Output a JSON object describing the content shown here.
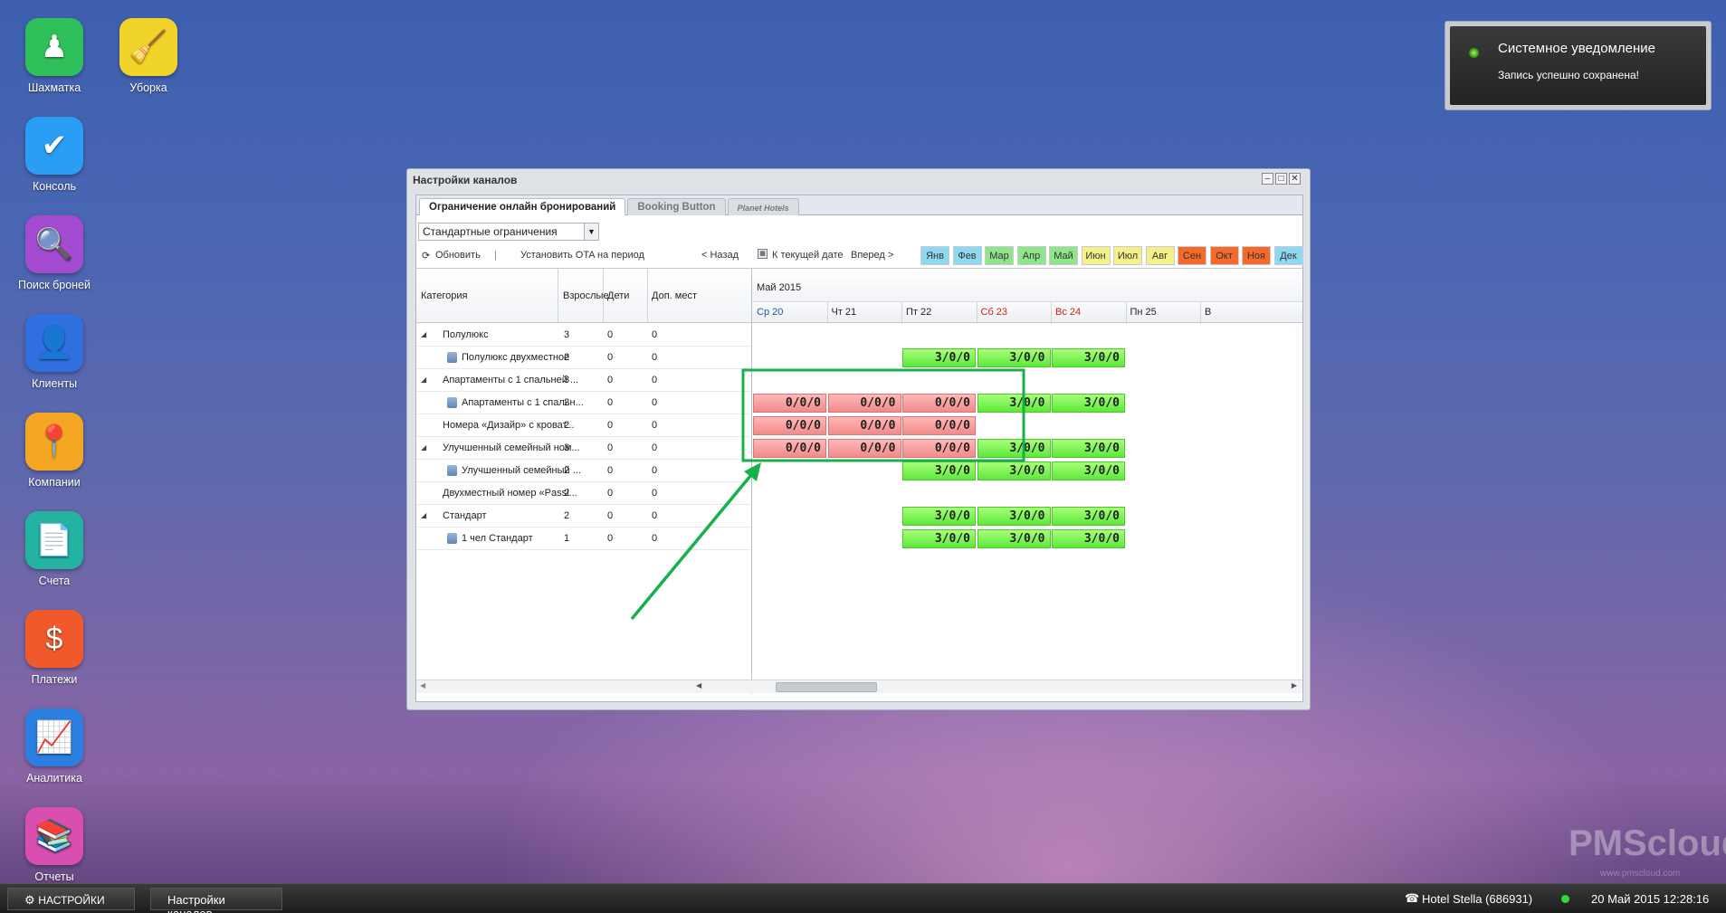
{
  "desktop": {
    "icons": [
      {
        "label": "Шахматка",
        "icon": "chess-pawn-icon",
        "color": "#2fbf5a"
      },
      {
        "label": "Уборка",
        "icon": "broom-icon",
        "color": "#f0d42a"
      },
      {
        "label": "Консоль",
        "icon": "checkmark-icon",
        "color": "#2a9df4"
      },
      {
        "label": "Поиск броней",
        "icon": "magnifier-icon",
        "color": "#a34bd1"
      },
      {
        "label": "Клиенты",
        "icon": "user-icon",
        "color": "#2f6fe0"
      },
      {
        "label": "Компании",
        "icon": "map-pin-icon",
        "color": "#f5a623"
      },
      {
        "label": "Счета",
        "icon": "document-icon",
        "color": "#23b3a0"
      },
      {
        "label": "Платежи",
        "icon": "dollar-icon",
        "color": "#f05a2a"
      },
      {
        "label": "Аналитика",
        "icon": "chart-line-icon",
        "color": "#2b7fe0"
      },
      {
        "label": "Отчеты",
        "icon": "books-icon",
        "color": "#d94fb0"
      }
    ]
  },
  "notification": {
    "title": "Системное уведомление",
    "message": "Запись успешно сохранена!"
  },
  "window": {
    "title": "Настройки каналов",
    "tabs": [
      "Ограничение онлайн бронирований",
      "Booking Button",
      "Planet Hotels"
    ],
    "restriction_select": "Стандартные ограничения",
    "toolbar": {
      "refresh": "Обновить",
      "divider": "|",
      "set_ota": "Установить OTA на период",
      "back": "< Назад",
      "today": "К текущей дате",
      "forward": "Вперед >"
    },
    "months": [
      {
        "label": "Янв",
        "color": "#8fd8f2"
      },
      {
        "label": "Фев",
        "color": "#8fd8f2"
      },
      {
        "label": "Мар",
        "color": "#8fe58a"
      },
      {
        "label": "Апр",
        "color": "#8fe58a"
      },
      {
        "label": "Май",
        "color": "#8fe58a"
      },
      {
        "label": "Июн",
        "color": "#f4f08a"
      },
      {
        "label": "Июл",
        "color": "#f4f08a"
      },
      {
        "label": "Авг",
        "color": "#f4f08a"
      },
      {
        "label": "Сен",
        "color": "#f56a2a"
      },
      {
        "label": "Окт",
        "color": "#f56a2a"
      },
      {
        "label": "Ноя",
        "color": "#f56a2a"
      },
      {
        "label": "Дек",
        "color": "#8fd8f2"
      }
    ],
    "columns": {
      "category": "Категория",
      "adults": "Взрослые",
      "children": "Дети",
      "extra": "Доп. мест"
    },
    "period": "Май 2015",
    "days": [
      {
        "label": "Ср 20",
        "color": "#1a5aa8"
      },
      {
        "label": "Чт 21",
        "color": "#222222"
      },
      {
        "label": "Пт 22",
        "color": "#222222"
      },
      {
        "label": "Сб 23",
        "color": "#d02020"
      },
      {
        "label": "Вс 24",
        "color": "#d02020"
      },
      {
        "label": "Пн 25",
        "color": "#222222"
      },
      {
        "label": "В",
        "color": "#222222"
      }
    ],
    "rows": [
      {
        "name": "Полулюкс",
        "group": true,
        "adults": "3",
        "children": "0",
        "extra": "0",
        "cells": [
          "",
          "",
          "",
          "",
          "",
          ""
        ]
      },
      {
        "name": "Полулюкс двухместное",
        "group": false,
        "icon": true,
        "adults": "2",
        "children": "0",
        "extra": "0",
        "cells": [
          "",
          "",
          "3/0/0",
          "3/0/0",
          "3/0/0",
          ""
        ]
      },
      {
        "name": "Апартаменты с 1 спальней ...",
        "group": true,
        "adults": "3",
        "children": "0",
        "extra": "0",
        "cells": [
          "",
          "",
          "",
          "",
          "",
          ""
        ]
      },
      {
        "name": "Апартаменты с 1 спальн...",
        "group": false,
        "icon": true,
        "adults": "2",
        "children": "0",
        "extra": "0",
        "cells": [
          "0/0/0",
          "0/0/0",
          "0/0/0",
          "3/0/0",
          "3/0/0",
          ""
        ]
      },
      {
        "name": "Номера «Дизайр» с кроват...",
        "group": false,
        "icon": false,
        "adults": "2",
        "children": "0",
        "extra": "0",
        "cells": [
          "0/0/0",
          "0/0/0",
          "0/0/0",
          "",
          "",
          ""
        ]
      },
      {
        "name": "Улучшенный семейный ном...",
        "group": true,
        "adults": "3",
        "children": "0",
        "extra": "0",
        "cells": [
          "0/0/0",
          "0/0/0",
          "0/0/0",
          "3/0/0",
          "3/0/0",
          ""
        ]
      },
      {
        "name": "Улучшенный семейный ...",
        "group": false,
        "icon": true,
        "adults": "2",
        "children": "0",
        "extra": "0",
        "cells": [
          "",
          "",
          "3/0/0",
          "3/0/0",
          "3/0/0",
          ""
        ]
      },
      {
        "name": "Двухместный номер «Passi...",
        "group": false,
        "icon": false,
        "adults": "2",
        "children": "0",
        "extra": "0",
        "cells": [
          "",
          "",
          "",
          "",
          "",
          ""
        ]
      },
      {
        "name": "Стандарт",
        "group": true,
        "adults": "2",
        "children": "0",
        "extra": "0",
        "cells": [
          "",
          "",
          "3/0/0",
          "3/0/0",
          "3/0/0",
          ""
        ]
      },
      {
        "name": "1 чел Стандарт",
        "group": false,
        "icon": true,
        "adults": "1",
        "children": "0",
        "extra": "0",
        "cells": [
          "",
          "",
          "3/0/0",
          "3/0/0",
          "3/0/0",
          ""
        ]
      }
    ]
  },
  "watermark": {
    "brand": "PMScloud",
    "url": "www.pmscloud.com"
  },
  "taskbar": {
    "settings": "НАСТРОЙКИ",
    "window": "Настройки каналов",
    "hotel": "Hotel Stella (686931)",
    "datetime": "20 Май 2015 12:28:16"
  }
}
